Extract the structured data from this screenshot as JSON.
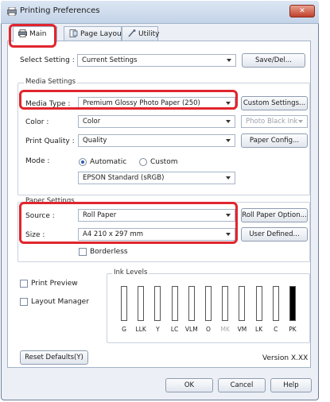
{
  "window": {
    "title": "Printing Preferences",
    "close_symbol": "✕"
  },
  "tabs": [
    {
      "label": "Main"
    },
    {
      "label": "Page Layout"
    },
    {
      "label": "Utility"
    }
  ],
  "select_setting": {
    "label": "Select Setting :",
    "value": "Current Settings",
    "button": "Save/Del..."
  },
  "media_settings": {
    "group_title": "Media Settings",
    "media_type": {
      "label": "Media Type :",
      "value": "Premium Glossy Photo Paper (250)",
      "button": "Custom Settings..."
    },
    "color": {
      "label": "Color :",
      "value": "Color",
      "ink_value": "Photo Black Ink"
    },
    "print_quality": {
      "label": "Print Quality :",
      "value": "Quality",
      "button": "Paper Config..."
    },
    "mode": {
      "label": "Mode :",
      "automatic": "Automatic",
      "custom": "Custom",
      "automatic_selected": true,
      "value": "EPSON Standard (sRGB)"
    }
  },
  "paper_settings": {
    "group_title": "Paper Settings",
    "source": {
      "label": "Source :",
      "value": "Roll Paper",
      "button": "Roll Paper Option..."
    },
    "size": {
      "label": "Size :",
      "value": "A4 210 x 297 mm",
      "button": "User Defined..."
    },
    "borderless": {
      "label": "Borderless",
      "checked": false
    }
  },
  "options": {
    "print_preview": {
      "label": "Print Preview",
      "checked": false
    },
    "layout_manager": {
      "label": "Layout Manager",
      "checked": false
    }
  },
  "ink_levels": {
    "title": "Ink Levels",
    "inks": [
      {
        "code": "G",
        "color": "#8a8a8a",
        "level": 0.0,
        "dim": false
      },
      {
        "code": "LLK",
        "color": "#b0b0b0",
        "level": 0.0,
        "dim": false
      },
      {
        "code": "Y",
        "color": "#e6d000",
        "level": 0.0,
        "dim": false
      },
      {
        "code": "LC",
        "color": "#7cc8e8",
        "level": 0.0,
        "dim": false
      },
      {
        "code": "VLM",
        "color": "#e8a0d0",
        "level": 0.0,
        "dim": false
      },
      {
        "code": "O",
        "color": "#f08020",
        "level": 0.0,
        "dim": false
      },
      {
        "code": "MK",
        "color": "#222222",
        "level": 0.0,
        "dim": true
      },
      {
        "code": "VM",
        "color": "#c8207a",
        "level": 0.0,
        "dim": false
      },
      {
        "code": "LK",
        "color": "#555555",
        "level": 0.0,
        "dim": false
      },
      {
        "code": "C",
        "color": "#0090d8",
        "level": 0.0,
        "dim": false
      },
      {
        "code": "PK",
        "color": "#000000",
        "level": 1.0,
        "dim": false
      }
    ]
  },
  "footer": {
    "reset_button": "Reset Defaults(Y)",
    "version": "Version X.XX"
  },
  "dialog_buttons": {
    "ok": "OK",
    "cancel": "Cancel",
    "help": "Help"
  },
  "colors": {
    "highlight": "#e0262e",
    "accent": "#2a5db0"
  }
}
